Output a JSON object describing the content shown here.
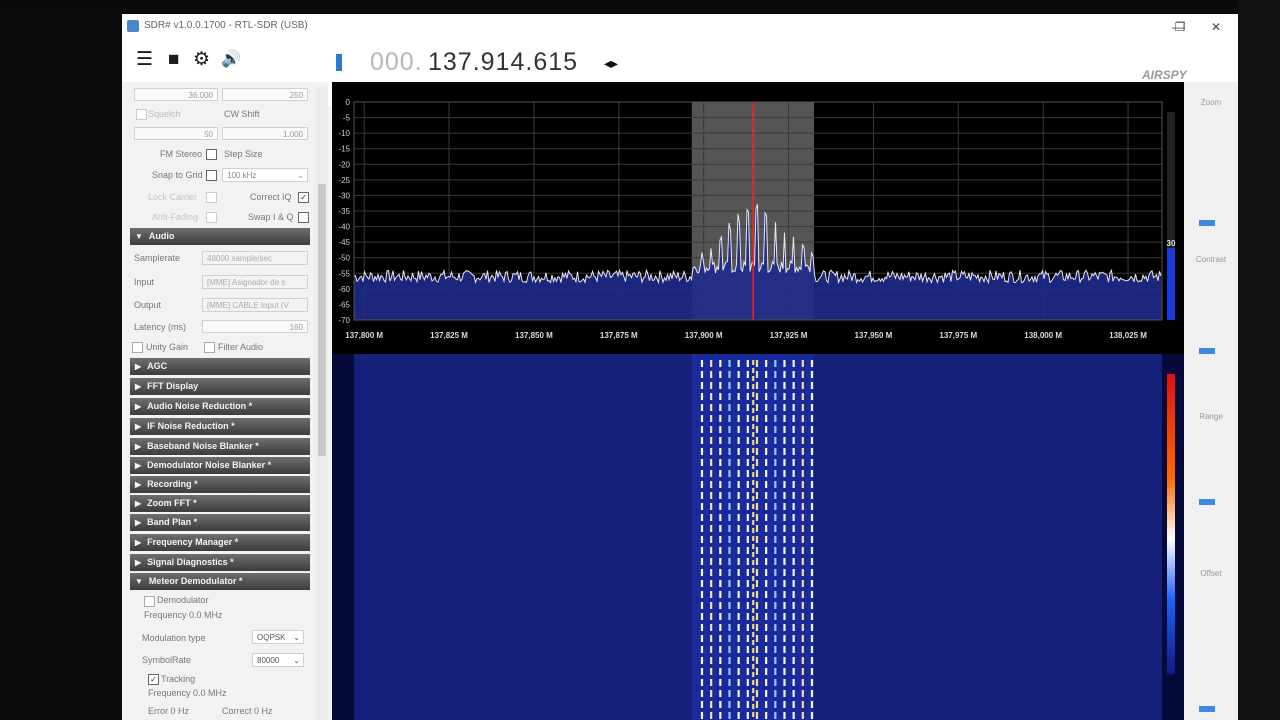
{
  "window": {
    "title": "SDR# v1.0.0.1700 - RTL-SDR (USB)",
    "controls": {
      "minimize": "—",
      "maximize": "❐",
      "close": "✕"
    }
  },
  "toolbar": {
    "menu_icon": "☰",
    "stop_icon": "■",
    "settings_icon": "⚙",
    "audio_icon": "🔊",
    "frequency_prefix": "000.",
    "frequency_main": "137.914.615",
    "tune_arrows": "◂▸",
    "brand": "AIRSPY"
  },
  "left_panel": {
    "bandwidth": "36.000",
    "order": "250",
    "squelch_label": "Squelch",
    "cw_shift_label": "CW Shift",
    "squelch_value": "50",
    "cw_shift_value": "1.000",
    "fm_stereo_label": "FM Stereo",
    "step_size_label": "Step Size",
    "snap_to_grid_label": "Snap to Grid",
    "step_size_value": "100 kHz",
    "lock_carrier_label": "Lock Carrier",
    "correct_iq_label": "Correct IQ",
    "anti_fading_label": "Anti-Fading",
    "swap_iq_label": "Swap I & Q",
    "audio_section": "Audio",
    "samplerate_label": "Samplerate",
    "samplerate_value": "48000 sample/sec",
    "input_label": "Input",
    "input_value": "[MME] Asignador de s",
    "output_label": "Output",
    "output_value": "[MME] CABLE Input (V",
    "latency_label": "Latency (ms)",
    "latency_value": "160",
    "unity_gain_label": "Unity Gain",
    "filter_audio_label": "Filter Audio",
    "sections": [
      "AGC",
      "FFT Display",
      "Audio Noise Reduction *",
      "IF Noise Reduction *",
      "Baseband Noise Blanker *",
      "Demodulator Noise Blanker *",
      "Recording *",
      "Zoom FFT *",
      "Band Plan *",
      "Frequency Manager *",
      "Signal Diagnostics *",
      "Meteor Demodulator *"
    ],
    "meteor": {
      "demodulator_label": "Demodulator",
      "frequency_label": "Frequency 0.0 MHz",
      "modulation_label": "Modulation type",
      "modulation_value": "OQPSK",
      "symbolrate_label": "SymbolRate",
      "symbolrate_value": "80000",
      "tracking_label": "Tracking",
      "tracking_freq_label": "Frequency 0.0 MHz",
      "error_label": "Error 0 Hz",
      "correct_label": "Correct 0 Hz"
    }
  },
  "right_panel": {
    "zoom_label": "Zoom",
    "contrast_label": "Contrast",
    "range_label": "Range",
    "offset_label": "Offset",
    "colors": {
      "thumb": "#3a8ae0"
    }
  },
  "chart_data": {
    "type": "line",
    "x_ticks": [
      "137,800 M",
      "137,825 M",
      "137,850 M",
      "137,875 M",
      "137,900 M",
      "137,925 M",
      "137,950 M",
      "137,975 M",
      "138,000 M",
      "138,025 M"
    ],
    "y_ticks": [
      "0",
      "-5",
      "-10",
      "-15",
      "-20",
      "-25",
      "-30",
      "-35",
      "-40",
      "-45",
      "-50",
      "-55",
      "-60",
      "-65",
      "-70"
    ],
    "xlim": [
      137.797,
      138.035
    ],
    "ylim": [
      -70,
      0
    ],
    "noise_floor_db": -56,
    "passband_mhz": [
      137.8965,
      137.9325
    ],
    "center_frequency_mhz": 137.9146,
    "signal_peak_db": -30,
    "level_bar_label": "30",
    "grid": true,
    "colors": {
      "background": "#000000",
      "grid": "#3a3a3a",
      "trace": "#e8e8f0",
      "fill": "#1f2a8a",
      "passband": "#9a9a9a",
      "center_line": "#ff2020",
      "waterfall_bg": "#14207a",
      "level_bar": "#1838d8"
    }
  }
}
